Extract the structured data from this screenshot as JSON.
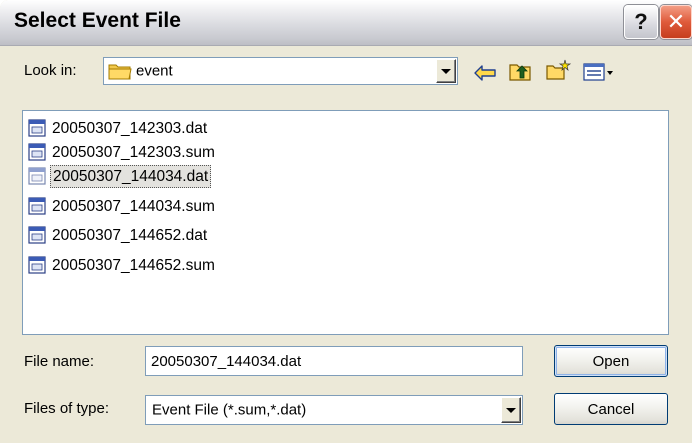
{
  "window": {
    "title": "Select Event File",
    "help_symbol": "?",
    "close_symbol": "✕"
  },
  "look_in": {
    "label": "Look in:",
    "value": "event",
    "icon": "folder-icon"
  },
  "toolbar": {
    "icons": [
      "back-arrow-icon",
      "up-folder-icon",
      "new-folder-icon",
      "view-menu-icon"
    ]
  },
  "files": [
    {
      "name": "20050307_142303.dat",
      "selected": false
    },
    {
      "name": "20050307_142303.sum",
      "selected": false
    },
    {
      "name": "20050307_144034.dat",
      "selected": true
    },
    {
      "name": "20050307_144034.sum",
      "selected": false
    },
    {
      "name": "20050307_144652.dat",
      "selected": false
    },
    {
      "name": "20050307_144652.sum",
      "selected": false
    }
  ],
  "file_name": {
    "label": "File name:",
    "value": "20050307_144034.dat"
  },
  "files_of_type": {
    "label": "Files of type:",
    "value": "Event File (*.sum,*.dat)"
  },
  "buttons": {
    "open": "Open",
    "cancel": "Cancel"
  },
  "colors": {
    "dialog_bg": "#ece9d8",
    "input_border": "#7f9db9",
    "close_button": "#df5b3b",
    "selection": "#e3e2de"
  }
}
